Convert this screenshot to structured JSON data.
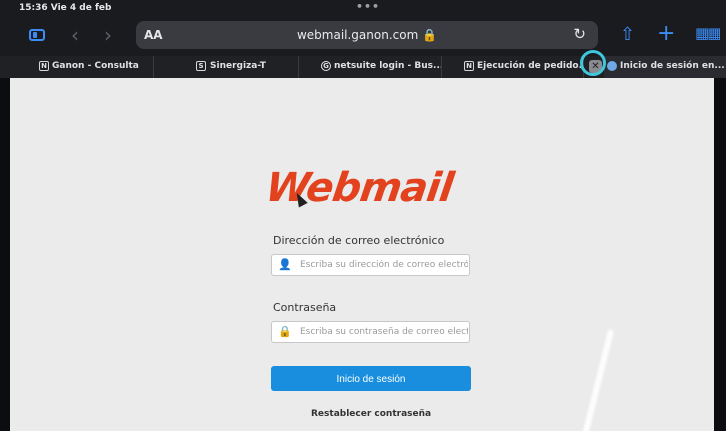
{
  "status_bar": {
    "time": "15:36  Vie 4 de feb",
    "dots": "•••"
  },
  "toolbar": {
    "aa_label": "AA",
    "url": "webmail.ganon.com 🔒"
  },
  "tabs": [
    {
      "favicon": "N",
      "label": "Ganon - Consulta"
    },
    {
      "favicon": "S",
      "label": "Sinergiza-T"
    },
    {
      "favicon": "G",
      "label": "netsuite login - Bus..."
    },
    {
      "favicon": "N",
      "label": "Ejecución de pedido..."
    },
    {
      "favicon": "",
      "label": "Inicio de sesión en..."
    }
  ],
  "page": {
    "logo": "Webmail",
    "email_label": "Dirección de correo electrónico",
    "email_placeholder": "Escriba su dirección de correo electrónico",
    "email_value": "",
    "password_label": "Contraseña",
    "password_placeholder": "Escriba su contraseña de correo electrónico",
    "password_value": "",
    "login_button": "Inicio de sesión",
    "reset_link": "Restablecer contraseña"
  },
  "colors": {
    "accent": "#3c8cf6",
    "logo": "#e3421f",
    "button": "#198ede",
    "highlight": "#3ec7dd"
  }
}
